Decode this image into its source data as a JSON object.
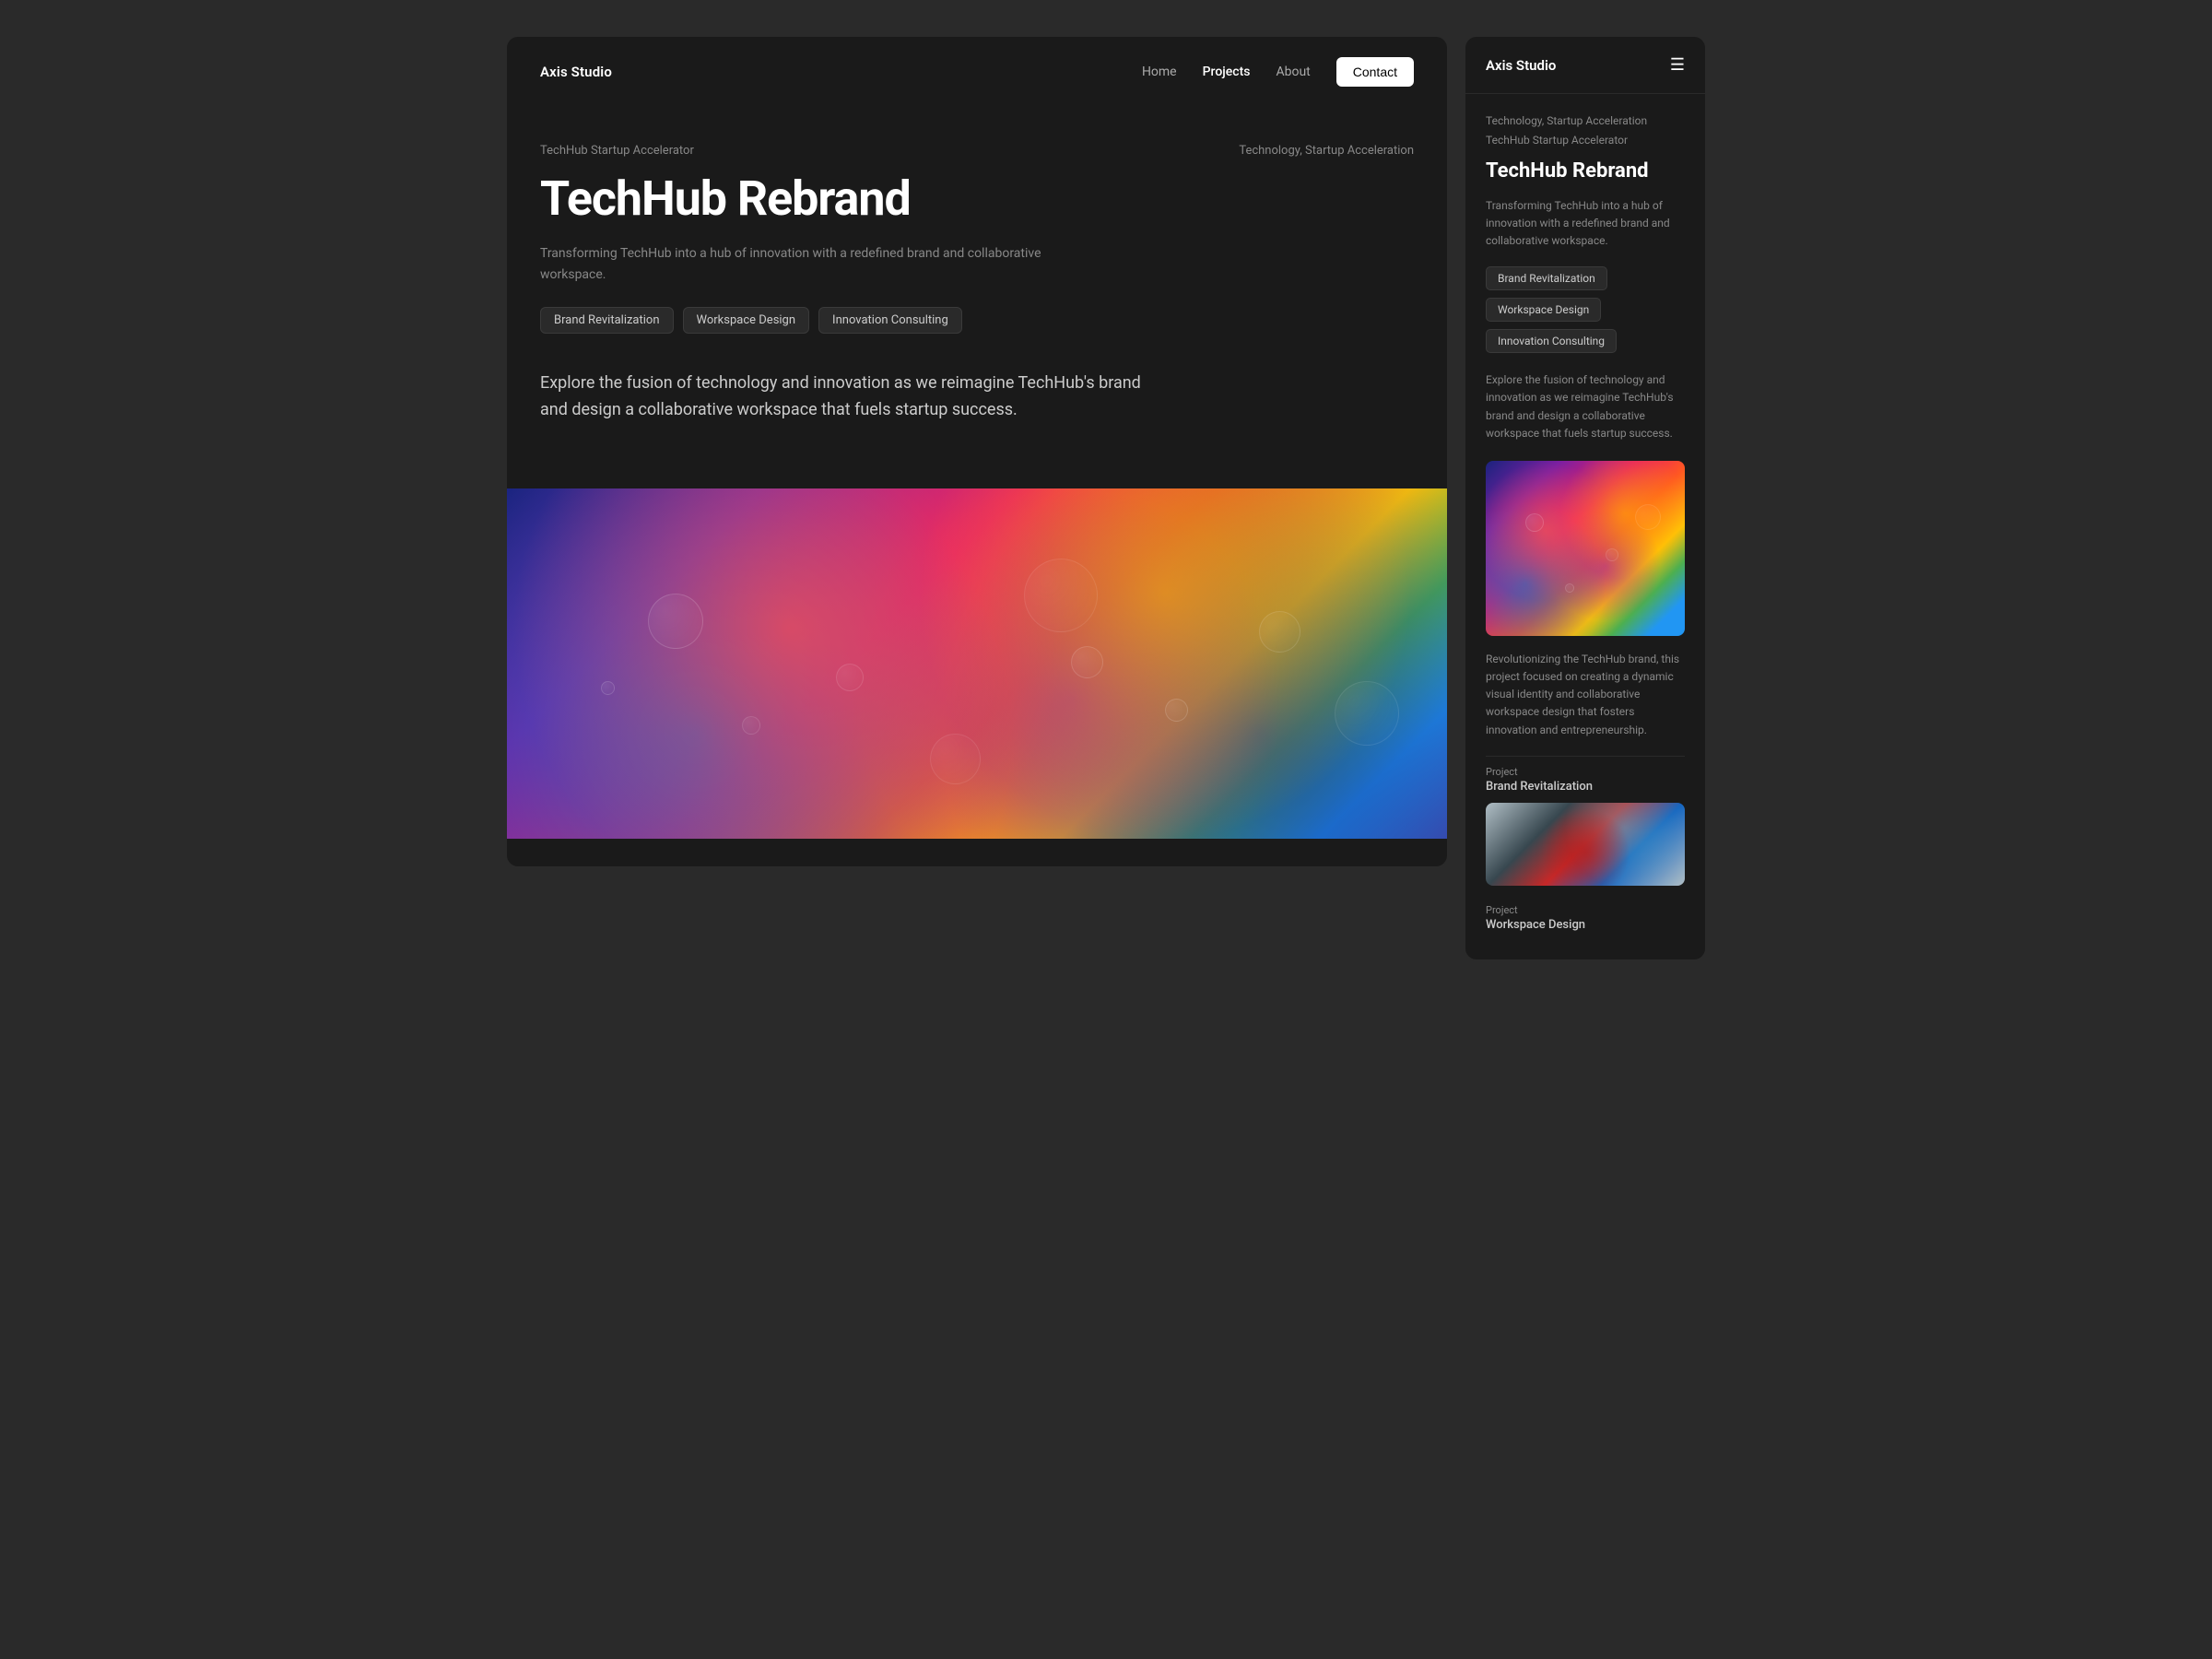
{
  "brand": {
    "logo": "Axis Studio"
  },
  "navbar": {
    "home": "Home",
    "projects": "Projects",
    "about": "About",
    "contact": "Contact"
  },
  "hero": {
    "category": "TechHub Startup Accelerator",
    "tags_meta": "Technology, Startup Acceleration",
    "title": "TechHub Rebrand",
    "description": "Transforming TechHub into a hub of innovation with a redefined brand and collaborative workspace.",
    "tag1": "Brand Revitalization",
    "tag2": "Workspace Design",
    "tag3": "Innovation Consulting",
    "body_text": "Explore the fusion of technology and innovation as we reimagine TechHub's brand and design a collaborative workspace that fuels startup success."
  },
  "sidebar": {
    "logo": "Axis Studio",
    "meta": "Technology, Startup Acceleration",
    "project_name": "TechHub Startup Accelerator",
    "title": "TechHub Rebrand",
    "description": "Transforming TechHub into a hub of innovation with a redefined brand and collaborative workspace.",
    "tag1": "Brand Revitalization",
    "tag2": "Workspace Design",
    "tag3": "Innovation Consulting",
    "body_text": "Explore the fusion of technology and innovation as we reimagine TechHub's brand and design a collaborative workspace that fuels startup success.",
    "rev_text": "Revolutionizing the TechHub brand, this project focused on creating a dynamic visual identity and collaborative workspace design that fosters innovation and entrepreneurship.",
    "project_item1_label": "Brand Revitalization",
    "project_item2_label": "Workspace Design"
  }
}
